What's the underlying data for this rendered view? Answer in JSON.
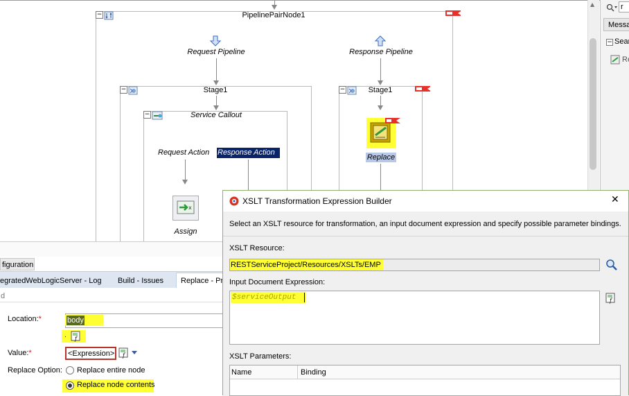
{
  "canvas": {
    "pipeline_pair_title": "PipelinePairNode1",
    "request_pipeline": "Request Pipeline",
    "response_pipeline": "Response Pipeline",
    "stage_left": "Stage1",
    "stage_right": "Stage1",
    "service_callout": "Service Callout",
    "request_action": "Request Action",
    "response_action": "Response Action",
    "assign": "Assign",
    "replace": "Replace"
  },
  "rightpane": {
    "search_value": "r",
    "messages_label": "Messa",
    "search_section": "Sear",
    "result_item": "Re"
  },
  "bottom": {
    "config_tab": "figuration",
    "log_tabs": [
      "egratedWebLogicServer - Log",
      "Build - Issues",
      "Replace - Pr"
    ],
    "filter_text": "d",
    "location_label": "Location:",
    "location_value": "body",
    "value_label": "Value:",
    "value_value": "<Expression>",
    "replace_option_label": "Replace Option:",
    "replace_entire": "Replace entire node",
    "replace_contents": "Replace node contents",
    "required_mark": "*",
    "small_dot": "."
  },
  "dialog": {
    "title": "XSLT Transformation Expression Builder",
    "close": "✕",
    "description": "Select an XSLT resource for transformation, an input document expression and specify possible parameter bindings.",
    "xslt_resource_label": "XSLT Resource:",
    "xslt_resource_value": "RESTServiceProject/Resources/XSLTs/EMP",
    "input_doc_label": "Input Document Expression:",
    "input_doc_value": "$serviceOutput",
    "params_label": "XSLT Parameters:",
    "params_columns": [
      "Name",
      "Binding"
    ]
  },
  "colors": {
    "highlight": "#ffff33",
    "selection_blue": "#0a246a",
    "flag_red": "#e8302a",
    "dialog_border": "#8fb06c"
  }
}
